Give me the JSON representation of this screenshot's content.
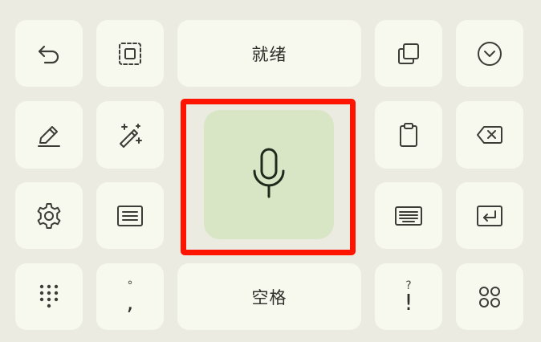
{
  "keyboard": {
    "ready_label": "就绪",
    "space_label": "空格",
    "punct_period_top": "°",
    "punct_comma": ",",
    "punct_question_top": "?",
    "punct_exclaim": "!"
  },
  "icons": {
    "undo": "undo-icon",
    "select": "select-region-icon",
    "copy": "copy-icon",
    "collapse": "chevron-down-circle-icon",
    "edit": "pencil-icon",
    "magic": "magic-wand-icon",
    "mic": "microphone-icon",
    "clipboard": "clipboard-icon",
    "backspace": "backspace-icon",
    "settings": "gear-icon",
    "text": "text-lines-icon",
    "keyboard": "keyboard-icon",
    "enter": "enter-icon",
    "numpad": "dot-grid-icon",
    "apps": "four-circles-icon"
  },
  "colors": {
    "background": "#ecebe2",
    "key": "#f7f8ee",
    "mic_key": "#d9e6c6",
    "highlight": "#ff1400"
  }
}
